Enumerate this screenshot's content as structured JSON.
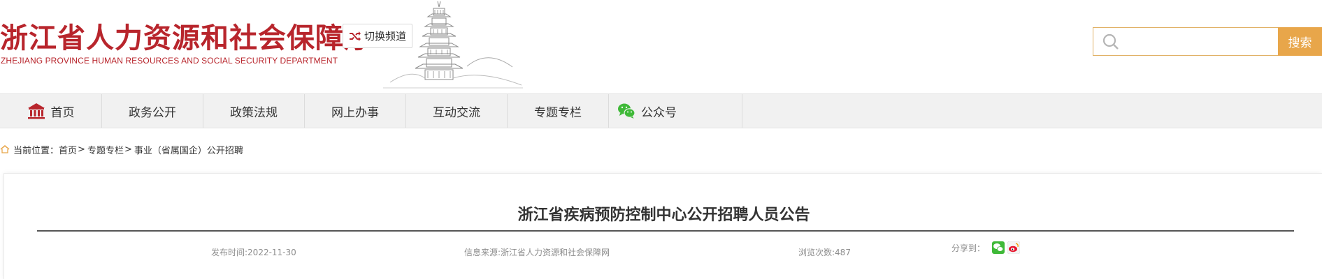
{
  "header": {
    "logo_cn": "浙江省人力资源和社会保障厅",
    "logo_en": "ZHEJIANG PROVINCE HUMAN RESOURCES AND SOCIAL SECURITY DEPARTMENT",
    "switch_channel": "切换频道",
    "search_placeholder": "",
    "search_button": "搜索"
  },
  "nav": {
    "items": [
      {
        "label": "首页",
        "icon": "home-icon"
      },
      {
        "label": "政务公开"
      },
      {
        "label": "政策法规"
      },
      {
        "label": "网上办事"
      },
      {
        "label": "互动交流"
      },
      {
        "label": "专题专栏"
      },
      {
        "label": "公众号",
        "icon": "wechat-icon"
      }
    ]
  },
  "breadcrumb": {
    "prefix": "当前位置：",
    "items": [
      "首页",
      "专题专栏",
      "事业（省属国企）公开招聘"
    ],
    "separator": ">"
  },
  "article": {
    "title": "浙江省疾病预防控制中心公开招聘人员公告",
    "publish_time": "发布时间:2022-11-30",
    "source": "信息来源:浙江省人力资源和社会保障网",
    "views": "浏览次数:487",
    "share_label": "分享到："
  },
  "colors": {
    "brand_red": "#b8252c",
    "search_accent": "#e8a64a",
    "nav_bg": "#f1f1f1",
    "wechat_green": "#3fb938",
    "weibo_red": "#e6162d"
  }
}
